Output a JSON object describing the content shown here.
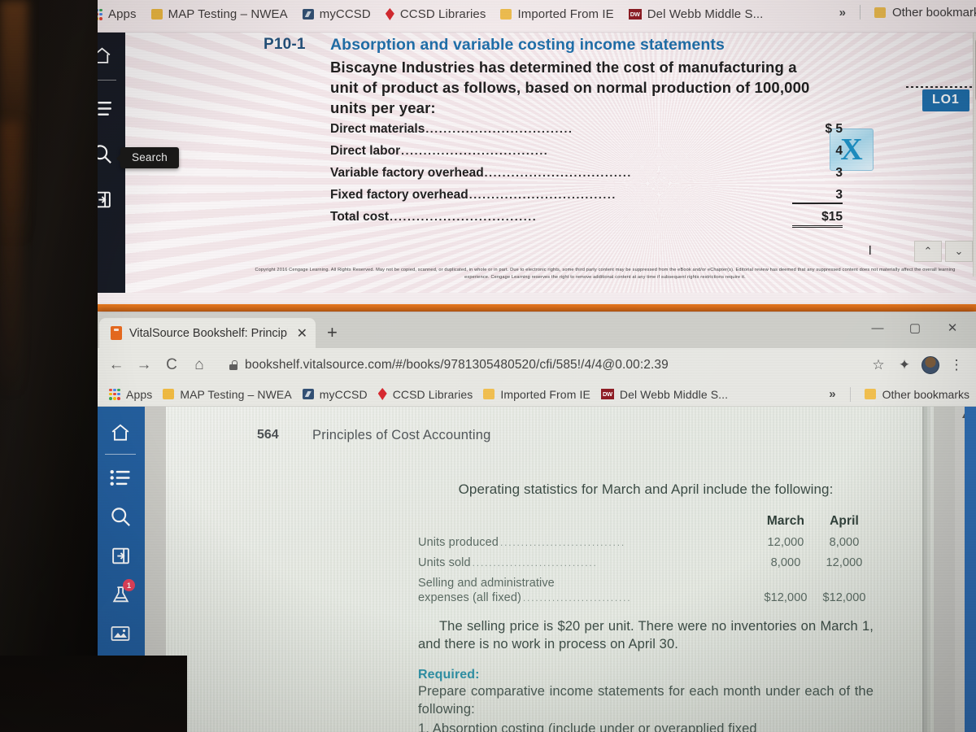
{
  "top_window": {
    "bookmarks_bar": {
      "apps_label": "Apps",
      "items": [
        {
          "label": "MAP Testing – NWEA",
          "icon": "folder-icon"
        },
        {
          "label": "myCCSD",
          "icon": "myccsd-icon"
        },
        {
          "label": "CCSD Libraries",
          "icon": "ccsd-libraries-icon"
        },
        {
          "label": "Imported From IE",
          "icon": "folder-icon"
        },
        {
          "label": "Del Webb Middle S...",
          "icon": "delwebb-icon"
        }
      ],
      "overflow_label": "»",
      "other_bookmarks_label": "Other bookmarks"
    },
    "sidebar": {
      "items": [
        {
          "name": "home-icon"
        },
        {
          "name": "table-of-contents-icon"
        },
        {
          "name": "search-icon"
        },
        {
          "name": "notebook-icon"
        }
      ]
    },
    "tooltip": "Search",
    "document": {
      "problem_number": "P10-1",
      "problem_title": "Absorption and variable costing income statements",
      "problem_body": "Biscayne Industries has determined the cost of manufacturing a unit of product as follows, based on normal production of 100,000 units per year:",
      "objective_badge": "LO1",
      "excel_icon_label": "X",
      "cost_rows": [
        {
          "label": "Direct materials",
          "amount": "$ 5",
          "rule": "none"
        },
        {
          "label": "Direct labor",
          "amount": "4",
          "rule": "none"
        },
        {
          "label": "Variable factory overhead",
          "amount": "3",
          "rule": "none"
        },
        {
          "label": "Fixed factory overhead",
          "amount": "3",
          "rule": "single"
        },
        {
          "label": "Total cost",
          "amount": "$15",
          "rule": "double"
        }
      ],
      "copyright": "Copyright 2016 Cengage Learning. All Rights Reserved. May not be copied, scanned, or duplicated, in whole or in part. Due to electronic rights, some third party content may be suppressed from the eBook and/or eChapter(s). Editorial review has deemed that any suppressed content does not materially affect the overall learning experience. Cengage Learning reserves the right to remove additional content at any time if subsequent rights restrictions require it."
    },
    "nav_chevrons": {
      "up": "⌃",
      "down": "⌄"
    }
  },
  "bottom_window": {
    "tab": {
      "title": "VitalSource Bookshelf: Principles",
      "close_label": "✕",
      "new_tab_label": "+"
    },
    "window_controls": {
      "minimize": "—",
      "maximize": "▢",
      "close": "✕"
    },
    "toolbar": {
      "back": "←",
      "forward": "→",
      "reload": "C",
      "home": "⌂",
      "url": "bookshelf.vitalsource.com/#/books/9781305480520/cfi/585!/4/4@0.00:2.39",
      "star": "☆",
      "extensions": "✦",
      "menu": "⋮"
    },
    "bookmarks_bar": {
      "apps_label": "Apps",
      "items": [
        {
          "label": "MAP Testing – NWEA",
          "icon": "folder-icon"
        },
        {
          "label": "myCCSD",
          "icon": "myccsd-icon"
        },
        {
          "label": "CCSD Libraries",
          "icon": "ccsd-libraries-icon"
        },
        {
          "label": "Imported From IE",
          "icon": "folder-icon"
        },
        {
          "label": "Del Webb Middle S...",
          "icon": "delwebb-icon"
        }
      ],
      "overflow_label": "»",
      "other_bookmarks_label": "Other bookmarks"
    },
    "sidebar": {
      "items": [
        {
          "name": "home-icon",
          "badge": ""
        },
        {
          "name": "table-of-contents-icon",
          "badge": ""
        },
        {
          "name": "search-icon",
          "badge": ""
        },
        {
          "name": "notebook-icon",
          "badge": ""
        },
        {
          "name": "flask-icon",
          "badge": "1"
        },
        {
          "name": "figures-icon",
          "badge": ""
        },
        {
          "name": "flashcards-icon",
          "badge": ""
        }
      ]
    },
    "reader": {
      "page_number": "564",
      "book_title": "Principles of Cost Accounting",
      "intro": "Operating statistics for March and April include the following:",
      "table": {
        "columns": [
          "March",
          "April"
        ],
        "rows": [
          {
            "label": "Units produced",
            "label2": "",
            "values": [
              "12,000",
              "8,000"
            ]
          },
          {
            "label": "Units sold",
            "label2": "",
            "values": [
              "8,000",
              "12,000"
            ]
          },
          {
            "label": "Selling and administrative",
            "label2": "expenses (all fixed)",
            "values": [
              "$12,000",
              "$12,000"
            ]
          }
        ]
      },
      "paragraph": "The selling price is $20 per unit. There were no inventories on March 1, and there is no work in process on April 30.",
      "required_title": "Required:",
      "required_intro": "Prepare comparative income statements for each month under each of the following:",
      "required_item_1": "1.  Absorption  costing  (include  under  or  overapplied  fixed"
    },
    "scrollbar": {
      "up_arrow": "▲"
    }
  },
  "colors": {
    "sidebar_top": "#141822",
    "sidebar_bottom": "#1f5b9c",
    "accent_orange": "#e8671c",
    "badge_blue": "#1f6fad",
    "badge_red": "#e8405a",
    "required_teal": "#2f93a8",
    "title_blue": "#1c6ca8"
  }
}
